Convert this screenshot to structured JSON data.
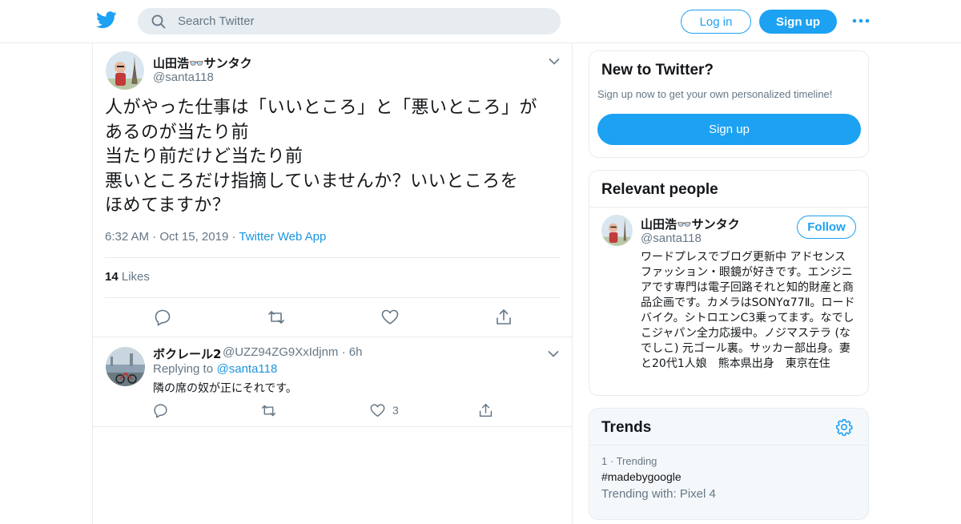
{
  "colors": {
    "brand": "#1da1f2",
    "link": "#1b95e0",
    "muted": "#657786",
    "border": "#e6ecf0"
  },
  "header": {
    "search_placeholder": "Search Twitter",
    "login_label": "Log in",
    "signup_label": "Sign up"
  },
  "tweet": {
    "author_name": "山田浩👓サンタク",
    "author_handle": "@santa118",
    "text": "人がやった仕事は「いいところ」と「悪いところ」が\nあるのが当たり前\n当たり前だけど当たり前\n悪いところだけ指摘していませんか？いいところを\nほめてますか？",
    "time": "6:32 AM",
    "date": "Oct 15, 2019",
    "source": "Twitter Web App",
    "likes_count": "14",
    "likes_label": "Likes"
  },
  "reply": {
    "author_name": "ボクレール2",
    "author_handle": "@UZZ94ZG9XxIdjnm",
    "time": "6h",
    "replying_to_label": "Replying to",
    "replying_to_handle": "@santa118",
    "text": "隣の席の奴が正にそれです。",
    "like_count": "3"
  },
  "sidebar": {
    "new_to_twitter": {
      "title": "New to Twitter?",
      "subtitle": "Sign up now to get your own personalized timeline!",
      "button": "Sign up"
    },
    "relevant_people": {
      "title": "Relevant people",
      "name": "山田浩👓サンタク",
      "handle": "@santa118",
      "follow_label": "Follow",
      "bio": "ワードプレスでブログ更新中 アドセンス　ファッション・眼鏡が好きです。エンジニアです専門は電子回路それと知的財産と商品企画です。カメラはSONYα77Ⅱ。ロードバイク。シトロエンC3乗ってます。なでしこジャパン全力応援中。ノジマステラ (なでしこ) 元ゴール裏。サッカー部出身。妻と20代1人娘　熊本県出身　東京在住"
    },
    "trends": {
      "title": "Trends",
      "items": [
        {
          "rank": "1",
          "label": "Trending",
          "name": "#madebygoogle",
          "with": "Trending with: Pixel 4"
        }
      ]
    }
  }
}
